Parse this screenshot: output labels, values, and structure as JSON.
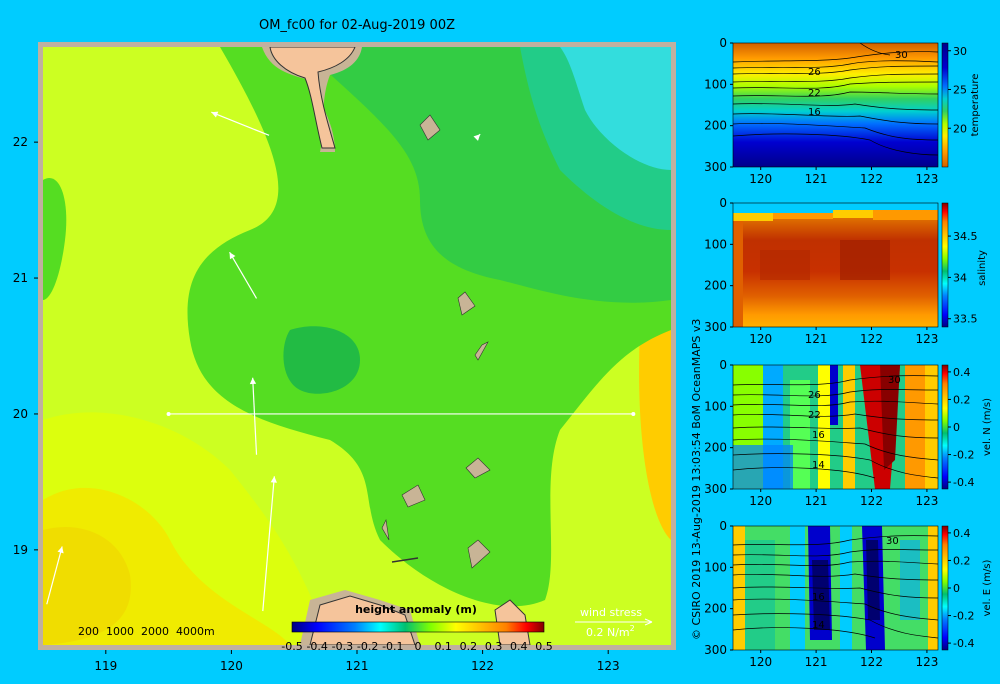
{
  "title": "OM_fc00 for 02-Aug-2019 00Z",
  "credit": "© CSIRO 2019  13-Aug-2019 13:03:54  BoM OceanMAPS v3",
  "colors": {
    "background": "#00ccff",
    "land": "#f5c49b",
    "shelf": "#c8b496",
    "frame": "#c0b0a0",
    "vector": "#ffffff",
    "colormap": [
      "#00007f",
      "#0000ff",
      "#0080ff",
      "#00ffff",
      "#00c070",
      "#80ff00",
      "#ffff00",
      "#ffc000",
      "#ff8000",
      "#ff0000",
      "#800000"
    ]
  },
  "icons": {
    "north_arrow": "arrow-icon"
  },
  "chart_data": [
    {
      "type": "heatmap",
      "name": "main-map",
      "xlabel": "",
      "ylabel": "",
      "xlim": [
        118.5,
        123.5
      ],
      "ylim": [
        18.3,
        22.7
      ],
      "xticks": [
        "119",
        "120",
        "121",
        "122",
        "123"
      ],
      "yticks": [
        "19",
        "20",
        "21",
        "22"
      ],
      "colorbar": {
        "label": "height anomaly (m)",
        "ticks": [
          "-0.5",
          "-0.4",
          "-0.3",
          "-0.2",
          "-0.1",
          "0",
          "0.1",
          "0.2",
          "0.3",
          "0.4",
          "0.5"
        ],
        "range": [
          -0.5,
          0.5
        ]
      },
      "section_line": {
        "lat": 20.0,
        "lon_start": 119.5,
        "lon_end": 123.2
      },
      "depth_contours_label": "200  1000  2000  4000m",
      "wind_legend": {
        "label": "wind stress",
        "value": "0.2 N/m",
        "superscript": "2",
        "magnitude": 0.2
      },
      "wind_vectors": [
        {
          "lon": 120.3,
          "lat": 22.05,
          "u": -0.15,
          "v": 0.06
        },
        {
          "lon": 120.2,
          "lat": 20.85,
          "u": -0.07,
          "v": 0.12
        },
        {
          "lon": 120.2,
          "lat": 19.7,
          "u": -0.01,
          "v": 0.2
        },
        {
          "lon": 120.25,
          "lat": 18.55,
          "u": 0.03,
          "v": 0.35
        },
        {
          "lon": 118.53,
          "lat": 18.6,
          "u": 0.04,
          "v": 0.15
        },
        {
          "lon": 121.95,
          "lat": 22.03,
          "u": 0.01,
          "v": 0.01
        }
      ]
    },
    {
      "type": "heatmap",
      "name": "temperature-section",
      "ylabel": "temperature",
      "xlim": [
        119.5,
        123.2
      ],
      "ylim": [
        300,
        0
      ],
      "xticks": [
        "120",
        "121",
        "122",
        "123"
      ],
      "yticks": [
        "0",
        "100",
        "200",
        "300"
      ],
      "colorbar": {
        "ticks": [
          "20",
          "25",
          "30"
        ],
        "range": [
          15,
          31
        ]
      },
      "contour_labels": [
        "30",
        "26",
        "22",
        "16"
      ]
    },
    {
      "type": "heatmap",
      "name": "salinity-section",
      "ylabel": "salinity",
      "xlim": [
        119.5,
        123.2
      ],
      "ylim": [
        300,
        0
      ],
      "xticks": [
        "120",
        "121",
        "122",
        "123"
      ],
      "yticks": [
        "0",
        "100",
        "200",
        "300"
      ],
      "colorbar": {
        "ticks": [
          "33.5",
          "34",
          "34.5"
        ],
        "range": [
          33.4,
          34.9
        ]
      }
    },
    {
      "type": "heatmap",
      "name": "vel-north-section",
      "ylabel": "vel. N (m/s)",
      "xlim": [
        119.5,
        123.2
      ],
      "ylim": [
        300,
        0
      ],
      "xticks": [
        "120",
        "121",
        "122",
        "123"
      ],
      "yticks": [
        "0",
        "100",
        "200",
        "300"
      ],
      "colorbar": {
        "ticks": [
          "-0.4",
          "-0.2",
          "0",
          "0.2",
          "0.4"
        ],
        "range": [
          -0.45,
          0.45
        ]
      },
      "contour_labels": [
        "30",
        "26",
        "22",
        "16",
        "14"
      ]
    },
    {
      "type": "heatmap",
      "name": "vel-east-section",
      "ylabel": "vel. E (m/s)",
      "xlim": [
        119.5,
        123.2
      ],
      "ylim": [
        300,
        0
      ],
      "xticks": [
        "120",
        "121",
        "122",
        "123"
      ],
      "yticks": [
        "0",
        "100",
        "200",
        "300"
      ],
      "colorbar": {
        "ticks": [
          "-0.4",
          "-0.2",
          "0",
          "0.2",
          "0.4"
        ],
        "range": [
          -0.45,
          0.45
        ]
      },
      "contour_labels": [
        "30",
        "16",
        "14"
      ]
    }
  ]
}
